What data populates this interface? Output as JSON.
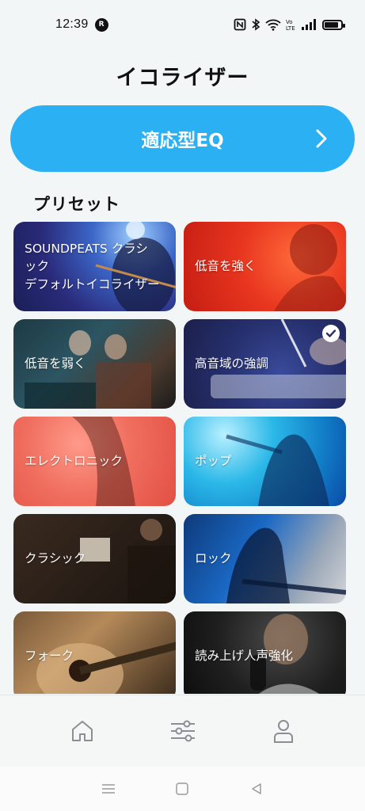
{
  "status": {
    "time": "12:39",
    "app_badge": "R",
    "battery_level": 0.85
  },
  "page_title": "イコライザー",
  "adaptive_eq": {
    "label": "適応型EQ",
    "icon": "chevron-right-icon"
  },
  "presets": {
    "title": "プリセット",
    "items": [
      {
        "label_line1": "SOUNDPEATS クラシ",
        "label_line2": "ック",
        "label_line3": "デフォルトイコライザー",
        "selected": false
      },
      {
        "label": "低音を強く",
        "selected": false
      },
      {
        "label": "低音を弱く",
        "selected": false
      },
      {
        "label": "高音域の強調",
        "selected": true
      },
      {
        "label": "エレクトロニック",
        "selected": false
      },
      {
        "label": "ポップ",
        "selected": false
      },
      {
        "label": "クラシック",
        "selected": false
      },
      {
        "label": "ロック",
        "selected": false
      },
      {
        "label": "フォーク",
        "selected": false
      },
      {
        "label": "読み上げ人声強化",
        "selected": false
      }
    ]
  },
  "bottom_nav": {
    "items": [
      {
        "icon": "home-icon"
      },
      {
        "icon": "sliders-icon"
      },
      {
        "icon": "user-icon"
      }
    ]
  },
  "system_nav": {
    "items": [
      {
        "icon": "menu-icon"
      },
      {
        "icon": "home-square-icon"
      },
      {
        "icon": "back-triangle-icon"
      }
    ]
  },
  "colors": {
    "accent": "#2bb0f3",
    "background": "#f3f6f6"
  }
}
